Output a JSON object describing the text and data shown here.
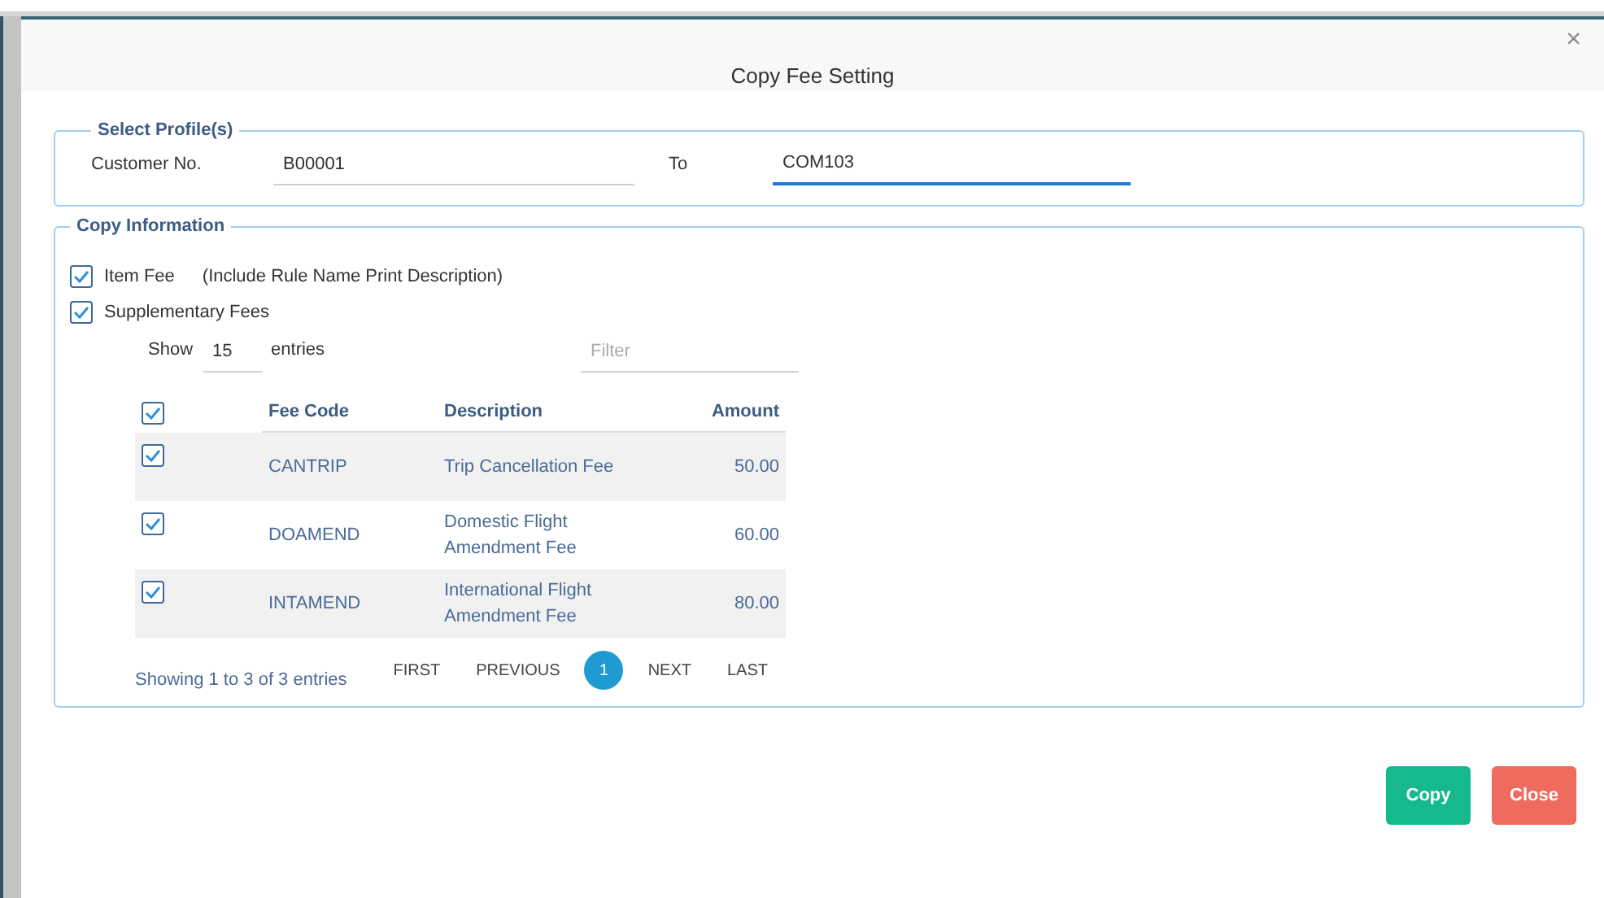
{
  "dialog": {
    "title": "Copy Fee Setting",
    "close_glyph": "×"
  },
  "select_profiles": {
    "legend": "Select Profile(s)",
    "customer_label": "Customer No.",
    "customer_value": "B00001",
    "to_label": "To",
    "to_value": "COM103",
    "to_focused": true
  },
  "copy_information": {
    "legend": "Copy Information",
    "options": [
      {
        "label": "Item Fee",
        "note": "(Include Rule Name Print Description)",
        "checked": true
      },
      {
        "label": "Supplementary Fees",
        "checked": true
      }
    ],
    "show_label": "Show",
    "page_size": "15",
    "entries_label": "entries",
    "filter": {
      "placeholder": "Filter"
    },
    "table": {
      "header_checked": true,
      "columns": [
        "Fee Code",
        "Description",
        "Amount"
      ],
      "rows": [
        {
          "checked": true,
          "code": "CANTRIP",
          "description": "Trip Cancellation Fee",
          "amount": "50.00"
        },
        {
          "checked": true,
          "code": "DOAMEND",
          "description": "Domestic Flight Amendment Fee",
          "amount": "60.00"
        },
        {
          "checked": true,
          "code": "INTAMEND",
          "description": "International Flight Amendment Fee",
          "amount": "80.00"
        }
      ]
    },
    "info": "Showing 1 to 3 of 3 entries",
    "pagination": [
      {
        "label": "FIRST",
        "selected": false
      },
      {
        "label": "PREVIOUS",
        "selected": false
      },
      {
        "label": "1",
        "selected": true
      },
      {
        "label": "NEXT",
        "selected": false
      },
      {
        "label": "LAST",
        "selected": false
      }
    ]
  },
  "buttons": [
    {
      "label": "Copy",
      "kind": "primary"
    },
    {
      "label": "Close",
      "kind": "danger"
    }
  ]
}
